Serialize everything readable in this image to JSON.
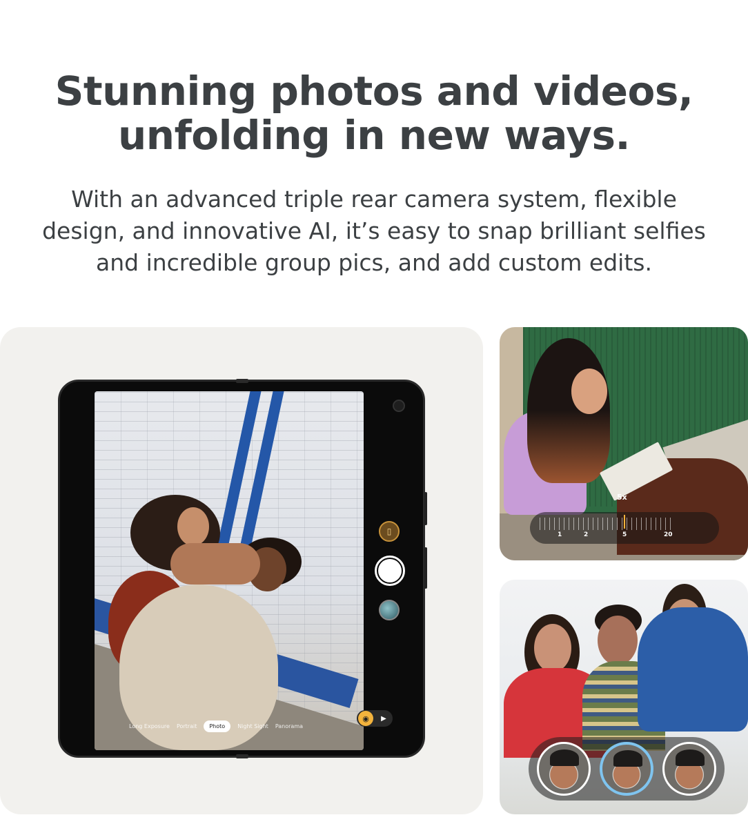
{
  "headline": {
    "line1": "Stunning photos and videos,",
    "line2": "unfolding in new ways."
  },
  "subhead": {
    "line1": "With an advanced triple rear camera system, flexible",
    "line2": "design, and innovative AI, it’s easy to snap brilliant selfies",
    "line3": "and incredible group pics, and add custom edits."
  },
  "camera_app": {
    "modes": [
      "Long Exposure",
      "Portrait",
      "Photo",
      "Night Sight",
      "Panorama"
    ],
    "active_mode": "Photo"
  },
  "zoom": {
    "current_label": "5x",
    "marks": [
      "1",
      "2",
      "5",
      "20"
    ]
  },
  "colors": {
    "text": "#3c4043",
    "card_bg": "#f2f1ee",
    "accent_yellow": "#f3b33d",
    "selected_ring": "#7fc4ef"
  },
  "icons": {
    "dual_screen": "dual-screen-icon",
    "shutter": "shutter-button",
    "gallery": "gallery-thumbnail",
    "photo_mode": "camera-icon",
    "video_mode": "video-icon"
  }
}
